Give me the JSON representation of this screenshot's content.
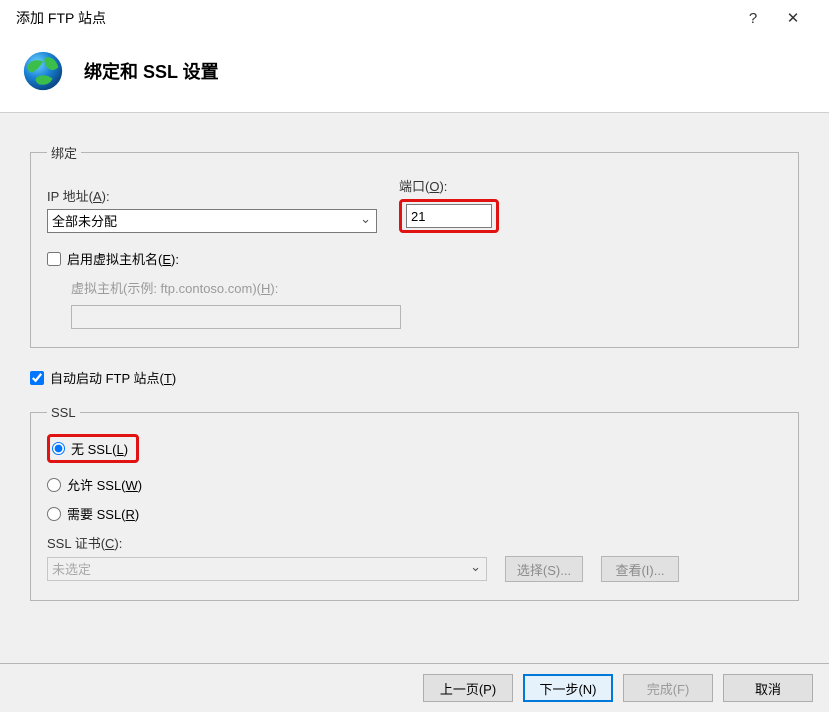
{
  "titlebar": {
    "title": "添加 FTP 站点",
    "help": "?",
    "close": "✕"
  },
  "header": {
    "title": "绑定和 SSL 设置"
  },
  "binding": {
    "legend": "绑定",
    "ip_label_pre": "IP 地址(",
    "ip_label_mn": "A",
    "ip_label_post": "):",
    "ip_value": "全部未分配",
    "port_label_pre": "端口(",
    "port_label_mn": "O",
    "port_label_post": "):",
    "port_value": "21",
    "enable_vhost_pre": "启用虚拟主机名(",
    "enable_vhost_mn": "E",
    "enable_vhost_post": "):",
    "vhost_label_pre": "虚拟主机(示例: ftp.contoso.com)(",
    "vhost_label_mn": "H",
    "vhost_label_post": "):",
    "vhost_value": ""
  },
  "auto_start": {
    "label_pre": "自动启动 FTP 站点(",
    "label_mn": "T",
    "label_post": ")"
  },
  "ssl": {
    "legend": "SSL",
    "no_ssl_pre": "无 SSL(",
    "no_ssl_mn": "L",
    "no_ssl_post": ")",
    "allow_ssl_pre": "允许 SSL(",
    "allow_ssl_mn": "W",
    "allow_ssl_post": ")",
    "require_ssl_pre": "需要 SSL(",
    "require_ssl_mn": "R",
    "require_ssl_post": ")",
    "cert_label_pre": "SSL 证书(",
    "cert_label_mn": "C",
    "cert_label_post": "):",
    "cert_value": "未选定",
    "select_btn": "选择(S)...",
    "view_btn": "查看(I)..."
  },
  "footer": {
    "prev": "上一页(P)",
    "next": "下一步(N)",
    "finish": "完成(F)",
    "cancel": "取消"
  }
}
